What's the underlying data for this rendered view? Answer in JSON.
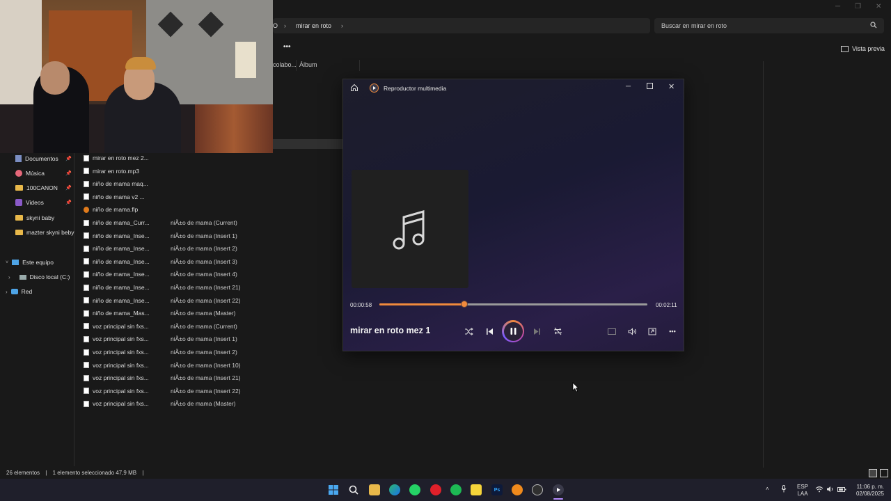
{
  "explorer": {
    "breadcrumb_prev": "O",
    "breadcrumb_current": "mirar en roto",
    "search_placeholder": "Buscar en mirar en roto",
    "more_label": "•••",
    "preview_label": "Vista previa",
    "col_collab": "colabo...",
    "col_album": "Álbum",
    "sidebar": [
      {
        "label": "Documentos",
        "icon": "documents-icon",
        "pinned": true
      },
      {
        "label": "Música",
        "icon": "music-folder-icon",
        "pinned": true
      },
      {
        "label": "100CANON",
        "icon": "folder-icon",
        "pinned": true
      },
      {
        "label": "Videos",
        "icon": "videos-folder-icon",
        "pinned": true
      },
      {
        "label": "skyni baby",
        "icon": "folder-icon",
        "pinned": false
      },
      {
        "label": "mazter skyni beby",
        "icon": "folder-icon",
        "pinned": false
      }
    ],
    "this_pc": "Este equipo",
    "local_disk": "Disco local (C:)",
    "network": "Red",
    "files": [
      {
        "name": "mirar en roto mez 2...",
        "album": "",
        "type": "audio"
      },
      {
        "name": "mirar en roto.mp3",
        "album": "",
        "type": "audio"
      },
      {
        "name": "niño de mama maq...",
        "album": "",
        "type": "audio"
      },
      {
        "name": "niño de mama v2 ...",
        "album": "",
        "type": "audio"
      },
      {
        "name": "niño de mama.flp",
        "album": "",
        "type": "flp"
      },
      {
        "name": "niño de mama_Curr...",
        "album": "niÃ±o de mama (Current)",
        "type": "audio"
      },
      {
        "name": "niño de mama_Inse...",
        "album": "niÃ±o de mama (Insert 1)",
        "type": "audio"
      },
      {
        "name": "niño de mama_Inse...",
        "album": "niÃ±o de mama (Insert 2)",
        "type": "audio"
      },
      {
        "name": "niño de mama_Inse...",
        "album": "niÃ±o de mama (Insert 3)",
        "type": "audio"
      },
      {
        "name": "niño de mama_Inse...",
        "album": "niÃ±o de mama (Insert 4)",
        "type": "audio"
      },
      {
        "name": "niño de mama_Inse...",
        "album": "niÃ±o de mama (Insert 21)",
        "type": "audio"
      },
      {
        "name": "niño de mama_Inse...",
        "album": "niÃ±o de mama (Insert 22)",
        "type": "audio"
      },
      {
        "name": "niño de mama_Mas...",
        "album": "niÃ±o de mama (Master)",
        "type": "audio"
      },
      {
        "name": "voz principal sin fxs...",
        "album": "niÃ±o de mama (Current)",
        "type": "audio"
      },
      {
        "name": "voz principal sin fxs...",
        "album": "niÃ±o de mama (Insert 1)",
        "type": "audio"
      },
      {
        "name": "voz principal sin fxs...",
        "album": "niÃ±o de mama (Insert 2)",
        "type": "audio"
      },
      {
        "name": "voz principal sin fxs...",
        "album": "niÃ±o de mama (Insert 10)",
        "type": "audio"
      },
      {
        "name": "voz principal sin fxs...",
        "album": "niÃ±o de mama (Insert 21)",
        "type": "audio"
      },
      {
        "name": "voz principal sin fxs...",
        "album": "niÃ±o de mama (Insert 22)",
        "type": "audio"
      },
      {
        "name": "voz principal sin fxs...",
        "album": "niÃ±o de mama (Master)",
        "type": "audio"
      }
    ],
    "status_count": "26 elementos",
    "status_selected": "1 elemento seleccionado  47,9 MB"
  },
  "player": {
    "title": "Reproductor multimedia",
    "song": "mirar en roto mez 1",
    "elapsed": "00:00:58",
    "total": "00:02:11",
    "progress_percent": 31.8,
    "accent": "#f08a3c"
  },
  "taskbar": {
    "lang": "ESP",
    "lang2": "LAA",
    "time": "11:06 p. m.",
    "date": "02/08/2025",
    "apps": [
      "start-icon",
      "search-icon",
      "file-explorer-icon",
      "edge-icon",
      "whatsapp-icon",
      "opera-icon",
      "spotify-icon",
      "sticky-notes-icon",
      "photoshop-icon",
      "fl-studio-icon",
      "obs-icon",
      "media-player-icon"
    ],
    "ps_label": "Ps"
  }
}
